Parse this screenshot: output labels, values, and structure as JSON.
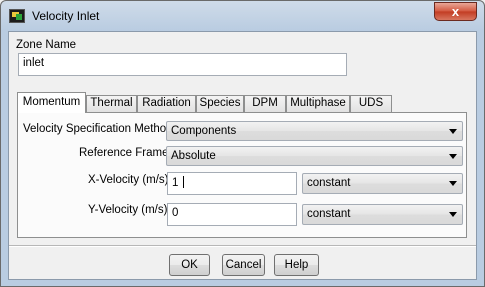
{
  "window": {
    "title": "Velocity Inlet",
    "close_symbol": "x"
  },
  "zone": {
    "label": "Zone Name",
    "value": "inlet"
  },
  "tabs": [
    {
      "label": "Momentum",
      "active": true
    },
    {
      "label": "Thermal"
    },
    {
      "label": "Radiation"
    },
    {
      "label": "Species"
    },
    {
      "label": "DPM"
    },
    {
      "label": "Multiphase"
    },
    {
      "label": "UDS"
    }
  ],
  "momentum": {
    "velocity_spec_label": "Velocity Specification Method",
    "velocity_spec_value": "Components",
    "reference_frame_label": "Reference Frame",
    "reference_frame_value": "Absolute",
    "x_velocity_label": "X-Velocity (m/s)",
    "x_velocity_value": "1",
    "x_velocity_profile": "constant",
    "y_velocity_label": "Y-Velocity (m/s)",
    "y_velocity_value": "0",
    "y_velocity_profile": "constant"
  },
  "buttons": {
    "ok": "OK",
    "cancel": "Cancel",
    "help": "Help"
  }
}
